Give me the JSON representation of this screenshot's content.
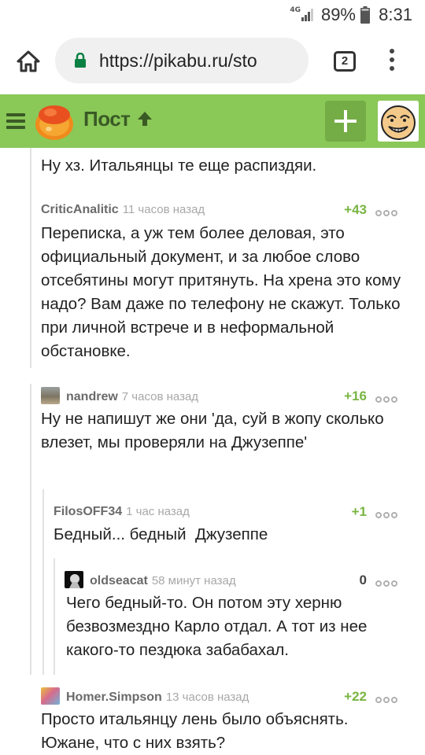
{
  "status_bar": {
    "network": "4G",
    "battery": "89%",
    "time": "8:31"
  },
  "browser": {
    "url": "https://pikabu.ru/sto",
    "tab_count": "2"
  },
  "site": {
    "title": "Пост",
    "accent": "#8ac858"
  },
  "comments": [
    {
      "author": "",
      "time": "",
      "rating": "",
      "text": "Ну хз. Итальянцы те еще распиздяи."
    },
    {
      "author": "CriticAnalitic",
      "time": "11 часов назад",
      "rating": "+43",
      "text": "Переписка, а уж тем более деловая, это официальный документ, и за любое слово отсебятины могут притянуть. На хрена это кому надо? Вам даже по телефону не скажут. Только при личной встрече и в неформальной обстановке."
    },
    {
      "author": "nandrew",
      "time": "7 часов назад",
      "rating": "+16",
      "text": "Ну не напишут же они 'да, суй в жопу сколько влезет, мы проверяли на Джузеппе'"
    },
    {
      "author": "FilosOFF34",
      "time": "1 час назад",
      "rating": "+1",
      "text": "Бедный... бедный  Джузеппе"
    },
    {
      "author": "oldseacat",
      "time": "58 минут назад",
      "rating": "0",
      "text": "Чего бедный-то. Он потом эту херню безвозмездно Карло отдал. А тот из нее какого-то пездюка забабахал."
    },
    {
      "author": "Homer.Simpson",
      "time": "13 часов назад",
      "rating": "+22",
      "text": "Просто итальянцу лень было объяснять. Южане, что с них взять?"
    }
  ]
}
